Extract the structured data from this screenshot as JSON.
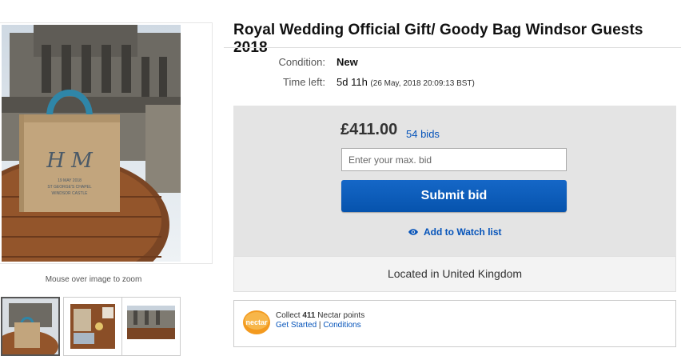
{
  "listing": {
    "title": "Royal Wedding Official Gift/ Goody Bag Windsor Guests 2018",
    "condition_label": "Condition:",
    "condition_value": "New",
    "time_left_label": "Time left:",
    "time_left_value": "5d 11h",
    "end_datetime": "(26 May, 2018   20:09:13 BST)"
  },
  "gallery": {
    "zoom_hint": "Mouse over image to zoom",
    "thumbnails": [
      "thumbnail-1",
      "thumbnail-2",
      "thumbnail-3"
    ],
    "bag_monogram": "H M",
    "bag_text_line1": "19 MAY 2018",
    "bag_text_line2": "ST GEORGE'S CHAPEL",
    "bag_text_line3": "WINDSOR CASTLE"
  },
  "bidding": {
    "price": "£411.00",
    "bid_count": "54 bids",
    "max_bid_placeholder": "Enter your max. bid",
    "submit_label": "Submit bid",
    "watch_label": "Add to Watch list"
  },
  "shipping": {
    "location": "Located in United Kingdom"
  },
  "nectar": {
    "logo_text": "nectar",
    "collect_prefix": "Collect",
    "points": "411",
    "collect_suffix": "Nectar points",
    "get_started": "Get Started",
    "separator": "|",
    "conditions": "Conditions"
  },
  "colors": {
    "link_blue": "#0654ba",
    "button_blue": "#0e5fbd",
    "bidbox_gray": "#e4e4e4",
    "nectar_orange": "#f39a1f"
  }
}
